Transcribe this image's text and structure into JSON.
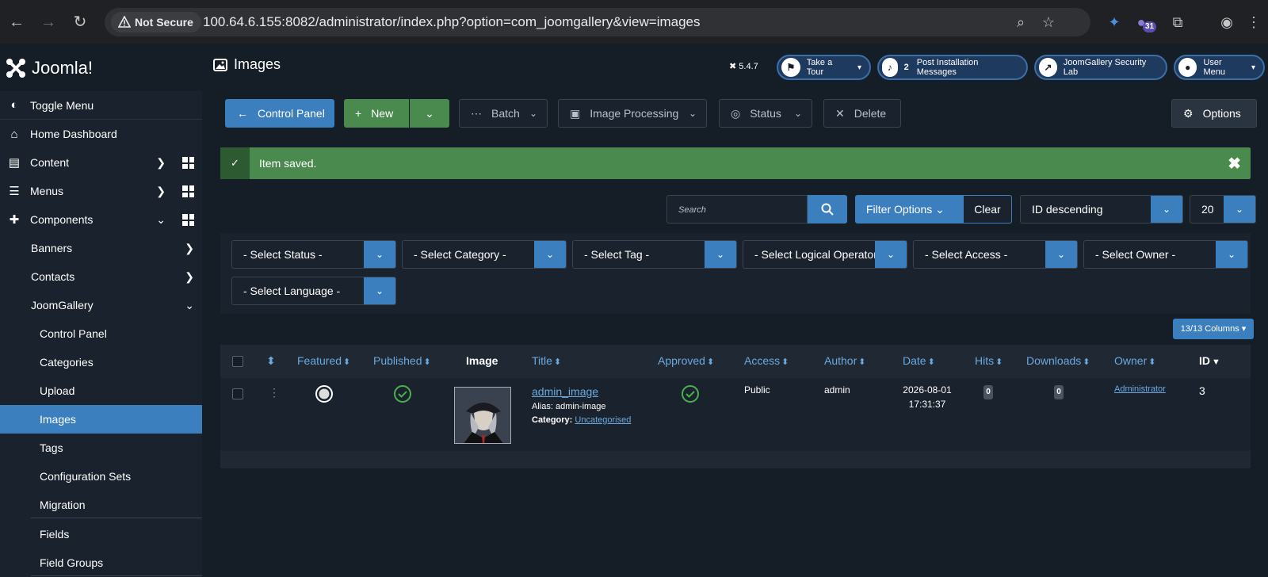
{
  "browser": {
    "secure_label": "Not Secure",
    "url": "100.64.6.155:8082/administrator/index.php?option=com_joomgallery&view=images",
    "ext_badge": "31"
  },
  "header": {
    "logo_text": "Joomla!",
    "page_title": "Images",
    "version": "5.4.7",
    "pills": [
      {
        "label": "Take a Tour",
        "icon": "signpost-icon"
      },
      {
        "label": "Post Installation Messages",
        "count": "2",
        "icon": "bell-icon"
      },
      {
        "label": "JoomGallery Security Lab",
        "icon": "external-link-icon"
      },
      {
        "label": "User Menu",
        "icon": "user-icon"
      }
    ]
  },
  "sidebar": {
    "items": [
      {
        "label": "Toggle Menu"
      },
      {
        "label": "Home Dashboard"
      },
      {
        "label": "Content"
      },
      {
        "label": "Menus"
      },
      {
        "label": "Components"
      },
      {
        "label": "Banners"
      },
      {
        "label": "Contacts"
      },
      {
        "label": "JoomGallery"
      },
      {
        "label": "Control Panel"
      },
      {
        "label": "Categories"
      },
      {
        "label": "Upload"
      },
      {
        "label": "Images"
      },
      {
        "label": "Tags"
      },
      {
        "label": "Configuration Sets"
      },
      {
        "label": "Migration"
      },
      {
        "label": "Fields"
      },
      {
        "label": "Field Groups"
      }
    ]
  },
  "toolbar": {
    "control_panel": "Control Panel",
    "new": "New",
    "batch": "Batch",
    "image_processing": "Image Processing",
    "status": "Status",
    "delete": "Delete",
    "options": "Options"
  },
  "alert": {
    "message": "Item saved.",
    "close": "✖"
  },
  "search": {
    "placeholder": "Search",
    "filter_options": "Filter Options",
    "clear": "Clear",
    "ordering": "ID descending",
    "limit": "20"
  },
  "filters": {
    "status": "- Select Status -",
    "category": "- Select Category -",
    "tag": "- Select Tag -",
    "logical": "- Select Logical Operator -",
    "access": "- Select Access -",
    "owner": "- Select Owner -",
    "language": "- Select Language -"
  },
  "columns_button": "13/13 Columns",
  "table": {
    "headers": {
      "featured": "Featured",
      "published": "Published",
      "image": "Image",
      "title": "Title",
      "approved": "Approved",
      "access": "Access",
      "author": "Author",
      "date": "Date",
      "hits": "Hits",
      "downloads": "Downloads",
      "owner": "Owner",
      "id": "ID"
    },
    "rows": [
      {
        "title": "admin_image",
        "alias": "Alias: admin-image",
        "category_label": "Category:",
        "category": "Uncategorised",
        "access": "Public",
        "author": "admin",
        "date": "2026-08-01",
        "time": "17:31:37",
        "hits": "0",
        "downloads": "0",
        "owner": "Administrator",
        "id": "3"
      }
    ]
  },
  "colors": {
    "accent": "#3b7fbf",
    "success": "#4a8a4f",
    "bg": "#151d27"
  }
}
